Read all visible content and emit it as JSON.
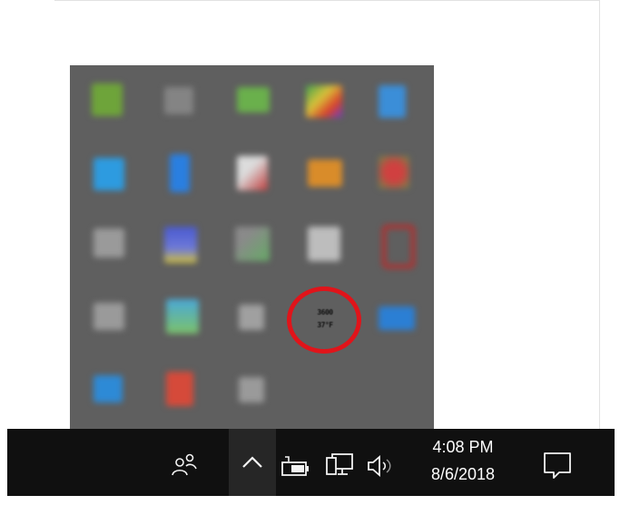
{
  "tray": {
    "icons": [
      {
        "icon": "nvidia-icon",
        "color": "#6ea43a"
      },
      {
        "icon": "app-icon",
        "color": "#8a8a8a"
      },
      {
        "icon": "battery-app-icon",
        "color": "#6ab04c"
      },
      {
        "icon": "color-palette-icon",
        "color": "#d4b23a"
      },
      {
        "icon": "bluetooth-style-icon",
        "color": "#3b8ed8"
      },
      {
        "icon": "windows-defender-icon",
        "color": "#2d9be0"
      },
      {
        "icon": "bluetooth-icon",
        "color": "#2a7fe0"
      },
      {
        "icon": "security-app-icon",
        "color": "#c8c8c8"
      },
      {
        "icon": "folder-sync-icon",
        "color": "#d98c2a"
      },
      {
        "icon": "red-app-icon",
        "color": "#b03030"
      },
      {
        "icon": "usb-icon",
        "color": "#9a9a9a"
      },
      {
        "icon": "photos-icon",
        "color": "#5060c0"
      },
      {
        "icon": "network-app-icon",
        "color": "#66aa66"
      },
      {
        "icon": "windows-app-icon",
        "color": "#bdbdbd"
      },
      {
        "icon": "red-ring-icon",
        "color": "#c02828"
      },
      {
        "icon": "printer-icon",
        "color": "#9a9a9a"
      },
      {
        "icon": "folder-icon",
        "color": "#4aa8d8"
      },
      {
        "icon": "eject-icon",
        "color": "#a0a0a0"
      },
      {
        "icon": "cpu-meter-icon",
        "color": "#333333"
      },
      {
        "icon": "onedrive-icon",
        "color": "#2b7fd4"
      },
      {
        "icon": "zoom-icon",
        "color": "#2d8ad6"
      },
      {
        "icon": "office-app-icon",
        "color": "#d54a3a"
      },
      {
        "icon": "device-icon",
        "color": "#9a9a9a"
      }
    ],
    "highlighted_text": {
      "line1": "3600",
      "line2": "37°F"
    },
    "highlight_color": "#e0141a"
  },
  "taskbar": {
    "clock": {
      "time": "4:08 PM",
      "date": "8/6/2018"
    },
    "icons": [
      "people-icon",
      "chevron-up-icon",
      "battery-icon",
      "network-icon",
      "volume-icon",
      "notification-icon"
    ]
  }
}
